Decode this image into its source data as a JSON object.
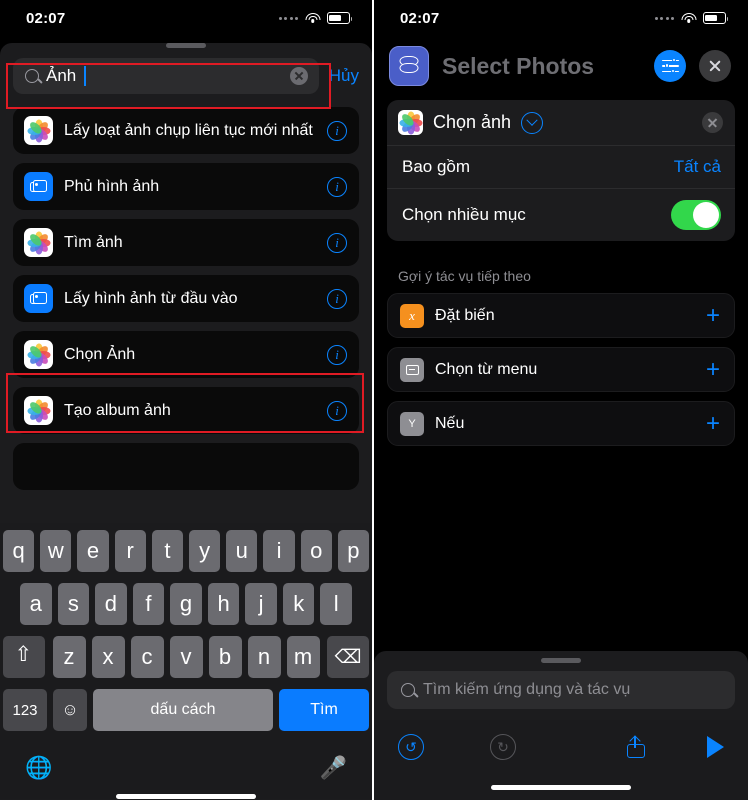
{
  "left": {
    "status": {
      "time": "02:07"
    },
    "search": {
      "value": "Ảnh",
      "cancel_label": "Hủy",
      "search_icon": "search-icon",
      "clear_icon": "clear-icon"
    },
    "results": [
      {
        "label": "Lấy loạt ảnh chụp liên tục mới nhất",
        "icon": "photos-app-icon",
        "info": "i"
      },
      {
        "label": "Phủ hình ảnh",
        "icon": "image-stack-icon",
        "info": "i"
      },
      {
        "label": "Tìm ảnh",
        "icon": "photos-app-icon",
        "info": "i"
      },
      {
        "label": "Lấy hình ảnh từ đầu vào",
        "icon": "image-stack-icon",
        "info": "i"
      },
      {
        "label": "Chọn Ảnh",
        "icon": "photos-app-icon",
        "info": "i",
        "highlighted": true
      },
      {
        "label": "Tạo album ảnh",
        "icon": "photos-app-icon",
        "info": "i"
      }
    ],
    "keyboard": {
      "row1": [
        "q",
        "w",
        "e",
        "r",
        "t",
        "y",
        "u",
        "i",
        "o",
        "p"
      ],
      "row2": [
        "a",
        "s",
        "d",
        "f",
        "g",
        "h",
        "j",
        "k",
        "l"
      ],
      "row3": [
        "z",
        "x",
        "c",
        "v",
        "b",
        "n",
        "m"
      ],
      "shift_icon": "shift-icon",
      "delete_icon": "backspace-icon",
      "numbers_label": "123",
      "emoji_icon": "emoji-icon",
      "space_label": "dấu cách",
      "go_label": "Tìm",
      "globe_icon": "globe-icon",
      "mic_icon": "microphone-icon"
    }
  },
  "right": {
    "status": {
      "time": "02:07"
    },
    "header": {
      "title": "Select Photos",
      "app_icon": "shortcuts-icon",
      "settings_icon": "sliders-icon",
      "close_icon": "close-icon"
    },
    "action": {
      "title": "Chọn ảnh",
      "icon": "photos-app-icon",
      "expand_icon": "chevron-down-icon",
      "remove_icon": "remove-action-icon",
      "rows": [
        {
          "key": "Bao gồm",
          "value": "Tất cả",
          "type": "value"
        },
        {
          "key": "Chọn nhiều mục",
          "value": "on",
          "type": "toggle"
        }
      ]
    },
    "suggestions": {
      "heading": "Gợi ý tác vụ tiếp theo",
      "items": [
        {
          "label": "Đặt biến",
          "icon": "variable-icon",
          "add": "+"
        },
        {
          "label": "Chọn từ menu",
          "icon": "menu-icon",
          "add": "+"
        },
        {
          "label": "Nếu",
          "icon": "if-icon",
          "add": "+"
        }
      ]
    },
    "bottom": {
      "search_placeholder": "Tìm kiếm ứng dụng và tác vụ",
      "search_icon": "search-icon",
      "undo_icon": "undo-icon",
      "redo_icon": "redo-icon",
      "share_icon": "share-icon",
      "play_icon": "play-icon"
    }
  },
  "colors": {
    "accent_blue": "#0a84ff",
    "toggle_green": "#32d74b",
    "annotation_red": "#e01b24",
    "orange_icon": "#f5901e"
  }
}
